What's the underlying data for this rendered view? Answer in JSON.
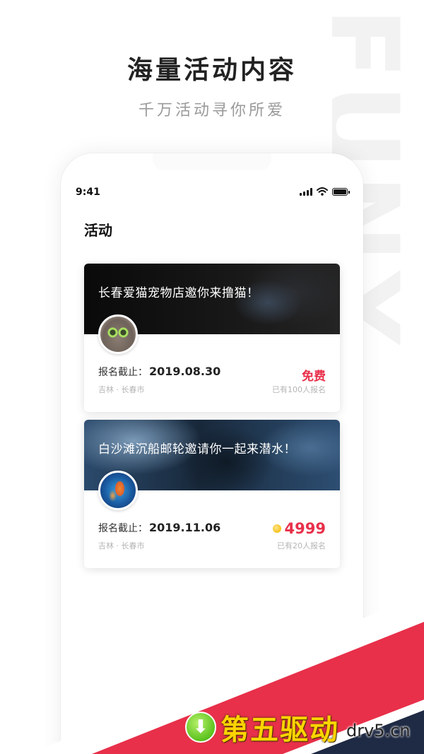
{
  "background_word": "FUNX",
  "hero": {
    "title": "海量活动内容",
    "subtitle": "千万活动寻你所爱"
  },
  "status_bar": {
    "time": "9:41",
    "icons": [
      "cellular-signal-icon",
      "wifi-icon",
      "battery-icon"
    ],
    "battery_level": 1.0
  },
  "page": {
    "title": "活动"
  },
  "events": [
    {
      "banner_text": "长春爱猫宠物店邀你来撸猫！",
      "avatar": "cat-avatar",
      "deadline_label": "报名截止：",
      "deadline_date": "2019.08.30",
      "location": "吉林 · 长春市",
      "price": "免费",
      "price_icon": null,
      "signups": "已有100人报名"
    },
    {
      "banner_text": "白沙滩沉船邮轮邀请你一起来潜水！",
      "avatar": "koi-avatar",
      "deadline_label": "报名截止：",
      "deadline_date": "2019.11.06",
      "location": "吉林 · 长春市",
      "price": "4999",
      "price_icon": "coin-icon",
      "signups": "已有20人报名"
    }
  ],
  "watermark": {
    "icon": "download-arrow-icon",
    "cn": "第五驱动",
    "en": "drv5.cn"
  },
  "colors": {
    "accent_red": "#e8304a",
    "stripe_navy": "#1f2a44",
    "coin_gold": "#f7c21b",
    "watermark_yellow": "#ffd400"
  }
}
